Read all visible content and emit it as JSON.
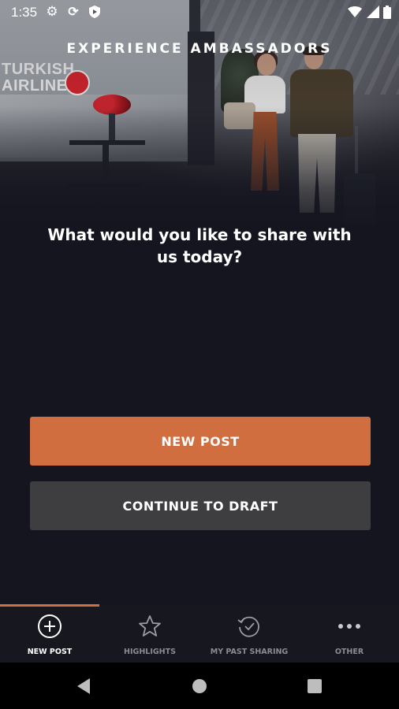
{
  "status_bar": {
    "time": "1:35",
    "icons": [
      "settings-gear-icon",
      "sync-icon",
      "shield-play-icon",
      "wifi-icon",
      "cellular-signal-icon",
      "battery-icon"
    ]
  },
  "hero": {
    "title": "EXPERIENCE AMBASSADORS",
    "image_sign_text": "TURKISH\nAIRLINES"
  },
  "prompt": {
    "text": "What would you like to share with us today?"
  },
  "actions": {
    "new_post_label": "NEW POST",
    "continue_draft_label": "CONTINUE TO DRAFT"
  },
  "bottom_nav": {
    "active_index": 0,
    "items": [
      {
        "label": "NEW POST",
        "icon": "add-circle-icon"
      },
      {
        "label": "HIGHLIGHTS",
        "icon": "star-icon"
      },
      {
        "label": "MY PAST SHARING",
        "icon": "history-check-icon"
      },
      {
        "label": "OTHER",
        "icon": "more-dots-icon"
      }
    ]
  },
  "system_nav": {
    "icons": [
      "back-icon",
      "home-icon",
      "recents-icon"
    ]
  },
  "colors": {
    "accent": "#d06e40",
    "background": "#14151f",
    "secondary_button": "#3e3e40",
    "nav_background": "#16171f",
    "inactive_label": "#8a8b93"
  }
}
